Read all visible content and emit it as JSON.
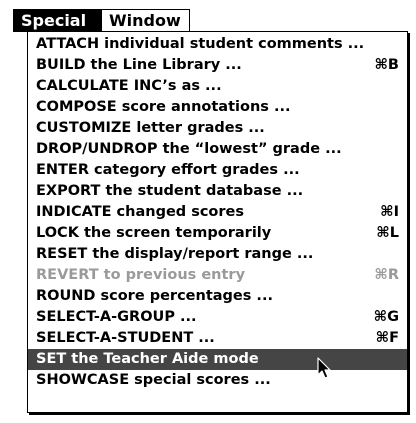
{
  "menubar": {
    "special": "Special",
    "window": "Window"
  },
  "menu": {
    "items": [
      {
        "label": "ATTACH individual student comments ...",
        "shortcut": ""
      },
      {
        "label": "BUILD the Line Library ...",
        "shortcut": "⌘B"
      },
      {
        "label": "CALCULATE INC’s as ...",
        "shortcut": ""
      },
      {
        "label": "COMPOSE score annotations ...",
        "shortcut": ""
      },
      {
        "label": "CUSTOMIZE letter grades ...",
        "shortcut": ""
      },
      {
        "label": "DROP/UNDROP the “lowest” grade ...",
        "shortcut": ""
      },
      {
        "label": "ENTER category effort grades ...",
        "shortcut": ""
      },
      {
        "label": "EXPORT the student database ...",
        "shortcut": ""
      },
      {
        "label": "INDICATE changed scores",
        "shortcut": "⌘I"
      },
      {
        "label": "LOCK the screen temporarily",
        "shortcut": "⌘L"
      },
      {
        "label": "RESET the display/report range ...",
        "shortcut": ""
      },
      {
        "label": "REVERT to previous entry",
        "shortcut": "⌘R"
      },
      {
        "label": "ROUND score percentages ...",
        "shortcut": ""
      },
      {
        "label": "SELECT-A-GROUP ...",
        "shortcut": "⌘G"
      },
      {
        "label": "SELECT-A-STUDENT ...",
        "shortcut": "⌘F"
      },
      {
        "label": "SET the Teacher Aide mode",
        "shortcut": ""
      },
      {
        "label": "SHOWCASE special scores ...",
        "shortcut": ""
      }
    ]
  },
  "icons": {
    "cursor": "arrow-pointer-icon"
  }
}
